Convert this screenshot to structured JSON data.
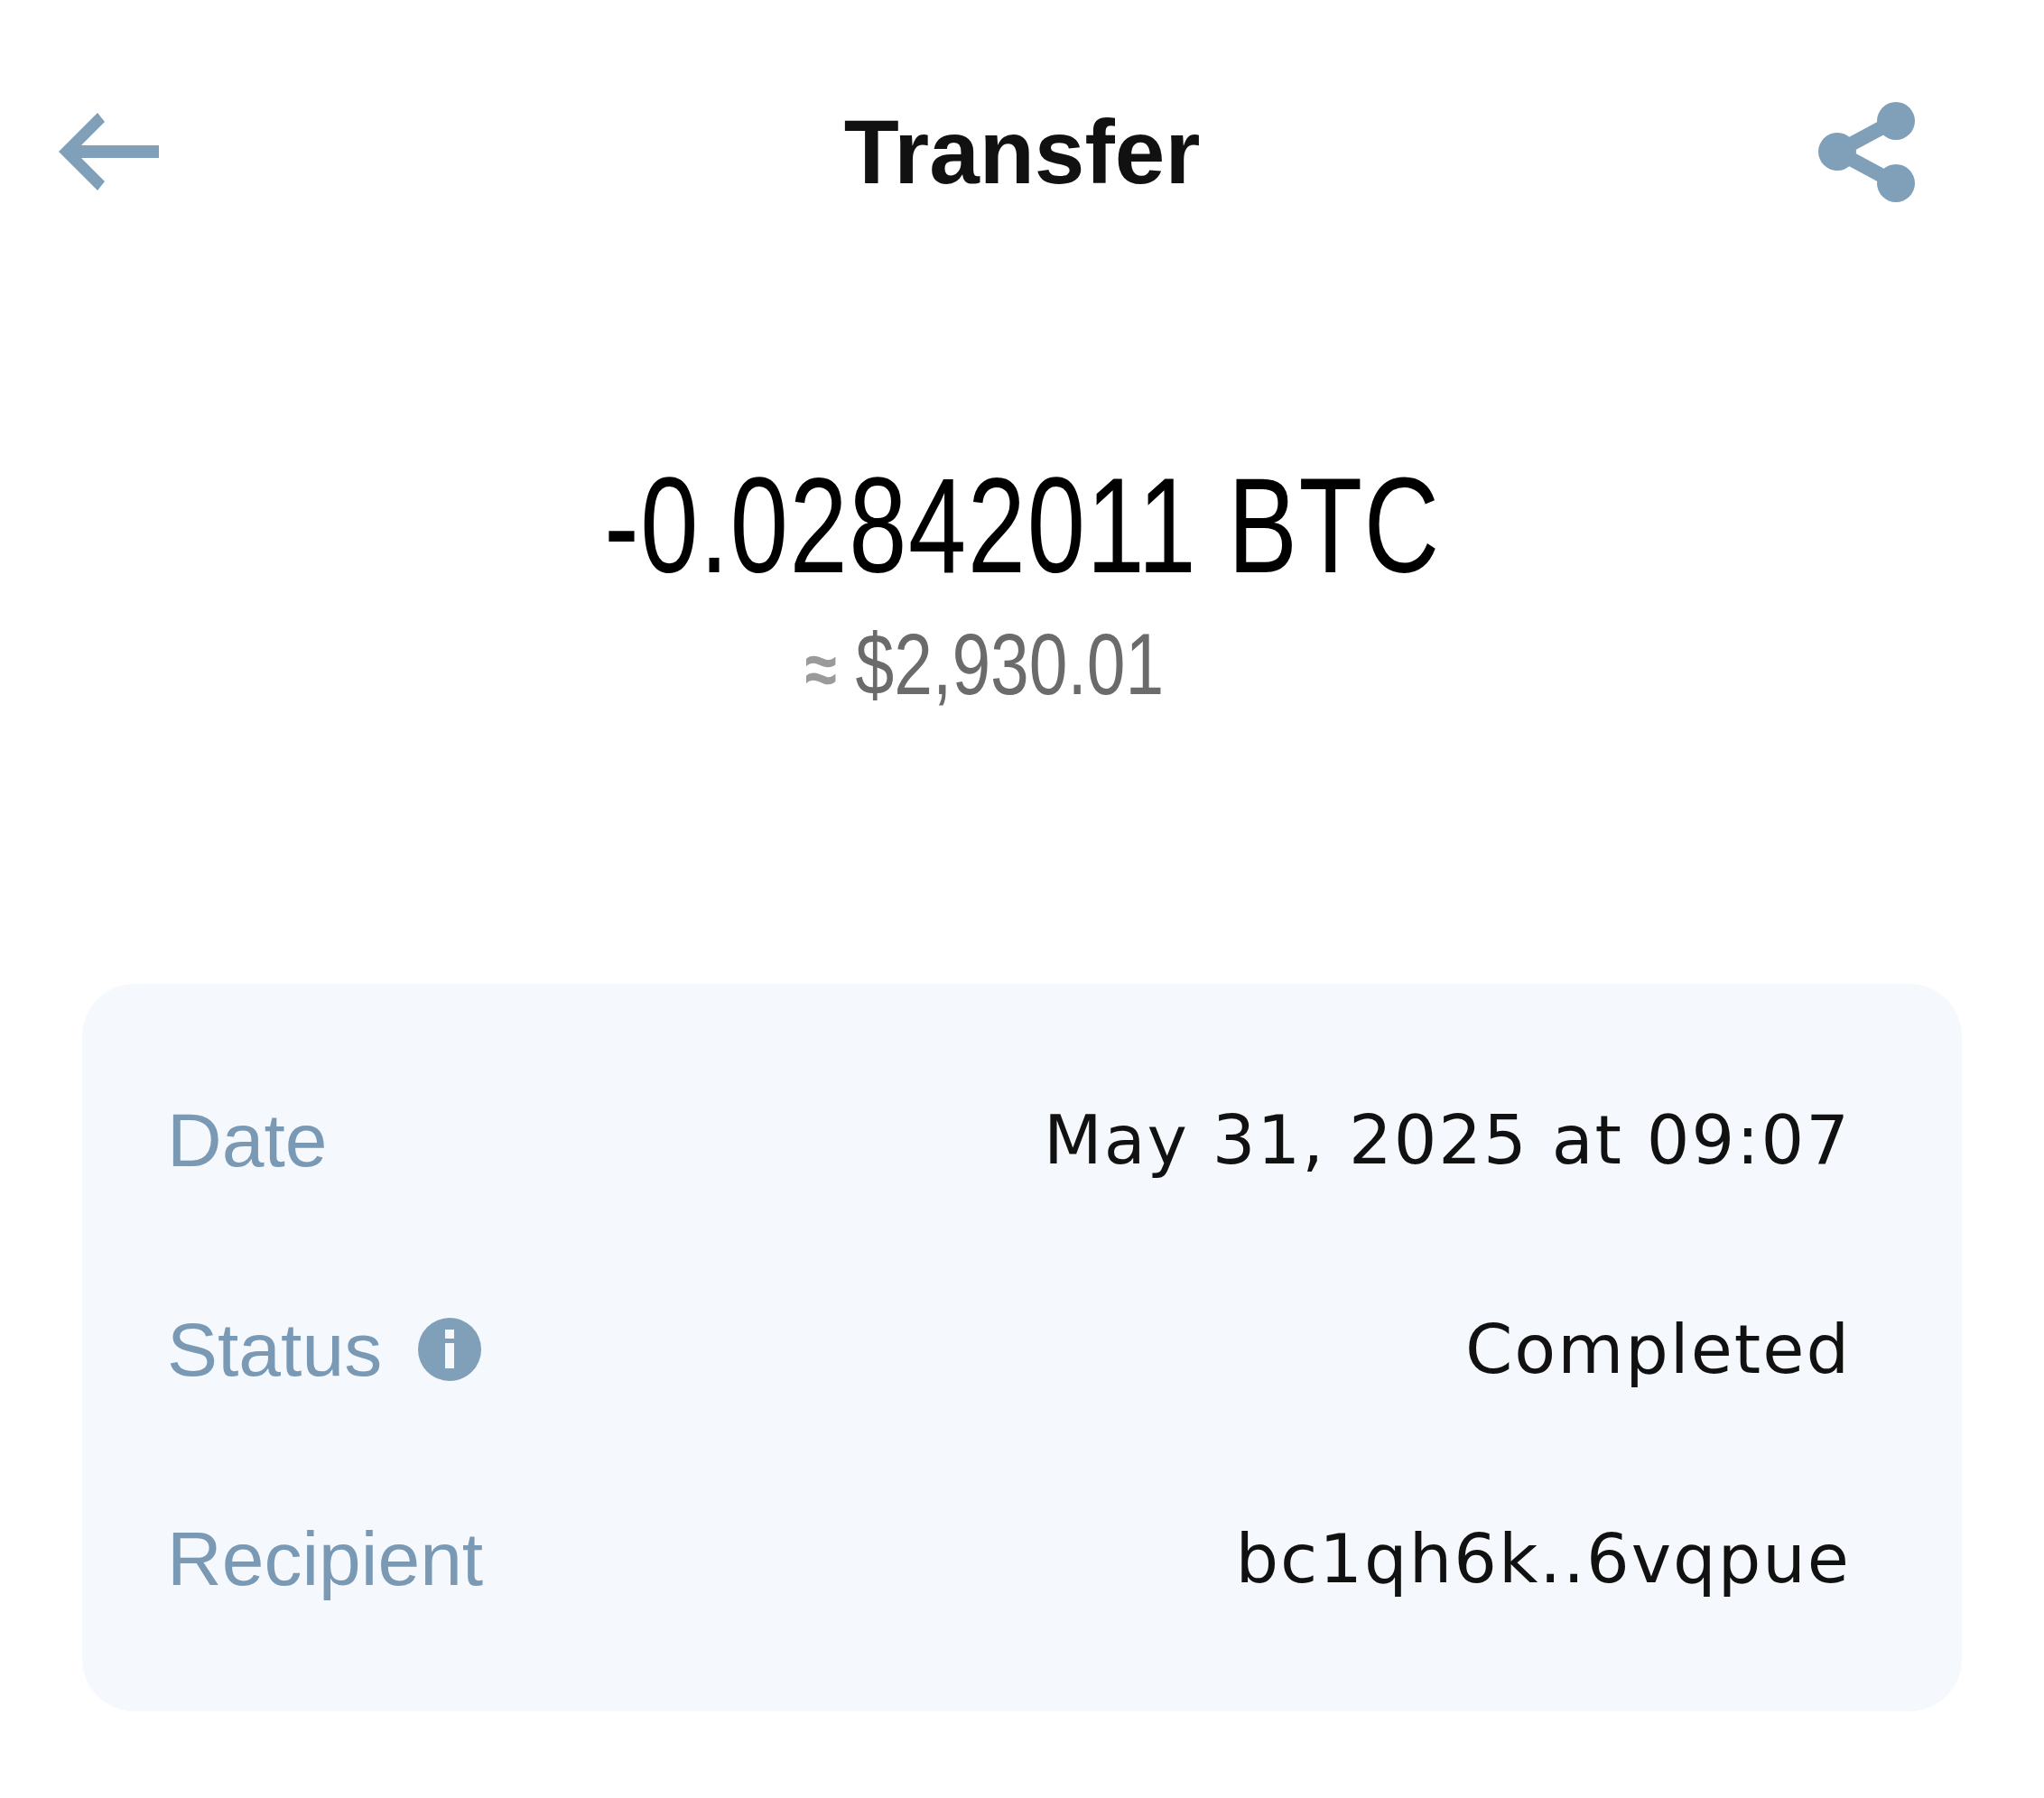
{
  "header": {
    "title": "Transfer"
  },
  "amount": {
    "value": "-0.02842011 BTC",
    "approx_sign": "≈",
    "fiat_value": "$2,930.01"
  },
  "details": [
    {
      "label": "Date",
      "value": "May 31, 2025 at 09:07",
      "info": false
    },
    {
      "label": "Status",
      "value": "Completed",
      "info": true
    },
    {
      "label": "Recipient",
      "value": "bc1qh6k..6vqpue",
      "info": false
    }
  ]
}
